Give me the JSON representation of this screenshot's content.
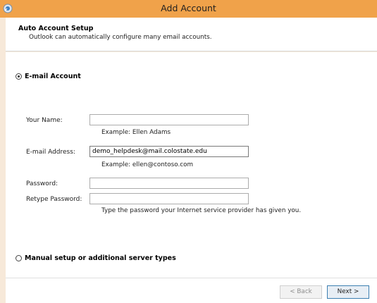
{
  "window": {
    "title": "Add Account"
  },
  "header": {
    "title": "Auto Account Setup",
    "subtitle": "Outlook can automatically configure many email accounts."
  },
  "email_account": {
    "radio_label": "E-mail Account",
    "selected": true,
    "name_label": "Your Name:",
    "name_value": "",
    "name_example": "Example: Ellen Adams",
    "email_label": "E-mail Address:",
    "email_value": "demo_helpdesk@mail.colostate.edu",
    "email_example": "Example: ellen@contoso.com",
    "password_label": "Password:",
    "password_value": "",
    "retype_label": "Retype Password:",
    "retype_value": "",
    "password_hint": "Type the password your Internet service provider has given you."
  },
  "manual_setup": {
    "radio_label": "Manual setup or additional server types",
    "selected": false
  },
  "buttons": {
    "back": "< Back",
    "next": "Next >"
  }
}
